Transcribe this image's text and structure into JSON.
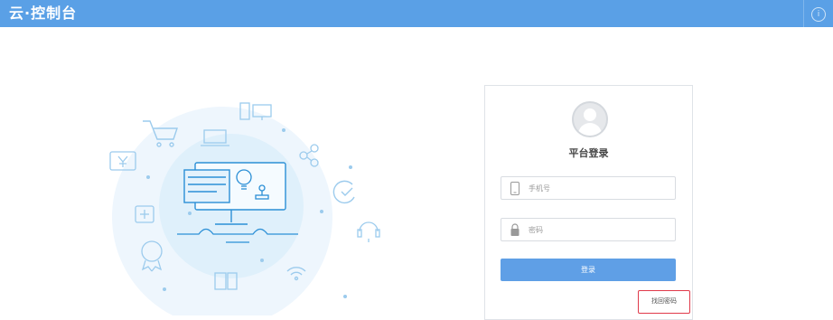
{
  "header": {
    "brand": "云·控制台",
    "info_icon": "info-circle-icon",
    "bg_color": "#5aa0e6"
  },
  "illustration": {
    "icons": [
      "shopping-cart-icon",
      "yen-sign-icon",
      "plus-icon",
      "vip-badge-icon",
      "laptop-icon",
      "phone-desktop-icon",
      "share-icon",
      "refresh-check-icon",
      "headset-icon",
      "wifi-icon",
      "tablet-icon",
      "monitor-icon",
      "lightbulb-icon",
      "stamp-icon"
    ]
  },
  "login": {
    "title": "平台登录",
    "avatar_icon": "user-avatar-icon",
    "phone_placeholder": "手机号",
    "phone_icon": "mobile-phone-icon",
    "password_placeholder": "密码",
    "password_icon": "lock-icon",
    "submit_label": "登录",
    "forgot_label": "找回密码",
    "accent_color": "#5f9fe6",
    "highlight_color": "#e03a4a"
  }
}
